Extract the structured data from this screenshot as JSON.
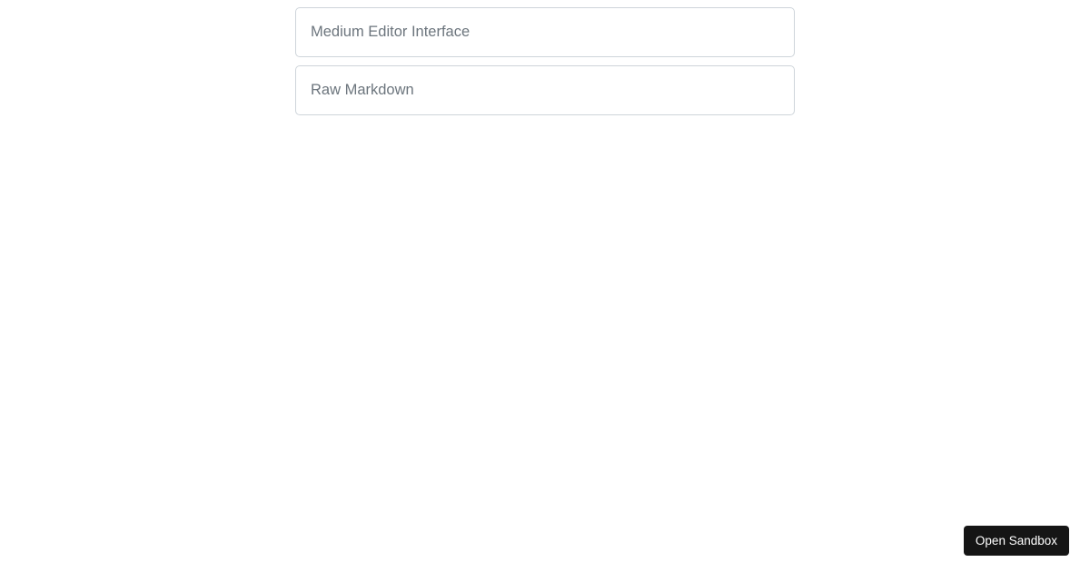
{
  "editor": {
    "medium_placeholder": "Medium Editor Interface",
    "markdown_placeholder": "Raw Markdown"
  },
  "footer": {
    "open_sandbox_label": "Open Sandbox"
  }
}
